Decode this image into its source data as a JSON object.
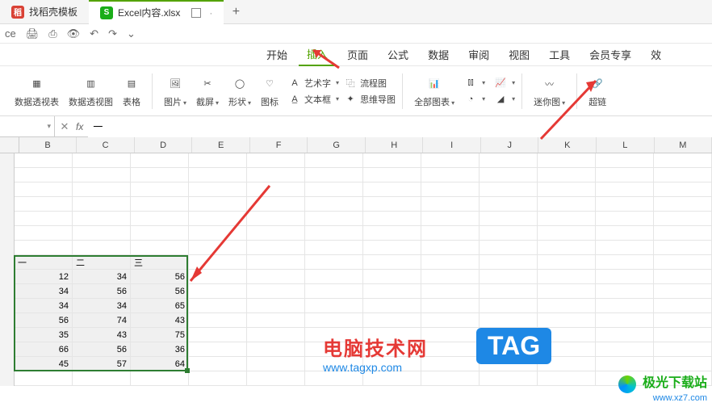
{
  "tabs": [
    {
      "icon_bg": "red",
      "icon_text": "稻",
      "label": "找稻壳模板"
    },
    {
      "icon_bg": "green",
      "icon_text": "S",
      "label": "Excel内容.xlsx"
    }
  ],
  "quick_access_left_cut": "ce",
  "ribbon_tabs": [
    "开始",
    "插入",
    "页面",
    "公式",
    "数据",
    "审阅",
    "视图",
    "工具",
    "会员专享",
    "效"
  ],
  "ribbon_active": "插入",
  "ribbon": {
    "pivot_table": "数据透视表",
    "pivot_chart": "数据透视图",
    "table": "表格",
    "picture": "图片",
    "screenshot": "截屏",
    "shapes": "形状",
    "icons": "图标",
    "wordart": "艺术字",
    "textbox": "文本框",
    "flowchart": "流程图",
    "mindmap": "思维导图",
    "all_charts": "全部图表",
    "sparkline": "迷你图",
    "hyperlink": "超链"
  },
  "formula_bar": {
    "name_box": "",
    "formula": "一"
  },
  "columns": [
    "B",
    "C",
    "D",
    "E",
    "F",
    "G",
    "H",
    "I",
    "J",
    "K",
    "L",
    "M"
  ],
  "chart_data": {
    "type": "table",
    "headers": [
      "一",
      "二",
      "三"
    ],
    "rows": [
      [
        12,
        34,
        56
      ],
      [
        34,
        56,
        56
      ],
      [
        34,
        34,
        65
      ],
      [
        56,
        74,
        43
      ],
      [
        35,
        43,
        75
      ],
      [
        66,
        56,
        36
      ],
      [
        45,
        57,
        64
      ]
    ]
  },
  "watermarks": {
    "site_title": "电脑技术网",
    "site_url": "www.tagxp.com",
    "tag_text": "TAG",
    "dl_title": "极光下载站",
    "dl_url": "www.xz7.com"
  }
}
